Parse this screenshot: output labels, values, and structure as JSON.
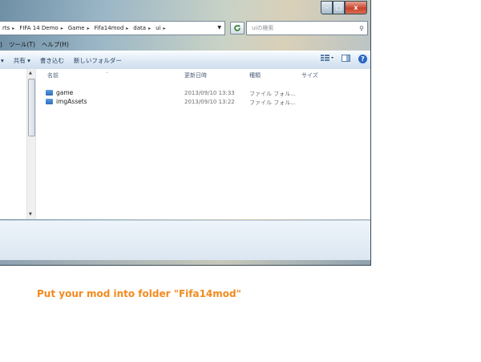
{
  "window": {
    "caption_buttons": {
      "minimize": "–",
      "maximize": "□",
      "close": "x"
    }
  },
  "address": {
    "crumbs": [
      "rts",
      "FIFA 14 Demo",
      "Game",
      "Fifa14mod",
      "data",
      "ui"
    ],
    "search_placeholder": "uiの検索"
  },
  "menubar": {
    "items": [
      ")",
      "ツール(T)",
      "ヘルプ(H)"
    ]
  },
  "toolbar": {
    "share_label": "共有 ▾",
    "burn_label": "書き込む",
    "new_folder_label": "新しいフォルダー",
    "view_icon": "view-options-icon",
    "preview_icon": "preview-pane-icon",
    "help_icon": "?"
  },
  "file_list": {
    "columns": [
      "名前",
      "更新日時",
      "種類",
      "サイズ"
    ],
    "rows": [
      {
        "name": "game",
        "modified": "2013/09/10 13:33",
        "type": "ファイル フォル..."
      },
      {
        "name": "imgAssets",
        "modified": "2013/09/10 13:22",
        "type": "ファイル フォル..."
      }
    ]
  },
  "instruction": "Put your mod into folder \"Fifa14mod\"",
  "colors": {
    "instruction": "#f28a1e",
    "folder": "#3a7bc8"
  }
}
